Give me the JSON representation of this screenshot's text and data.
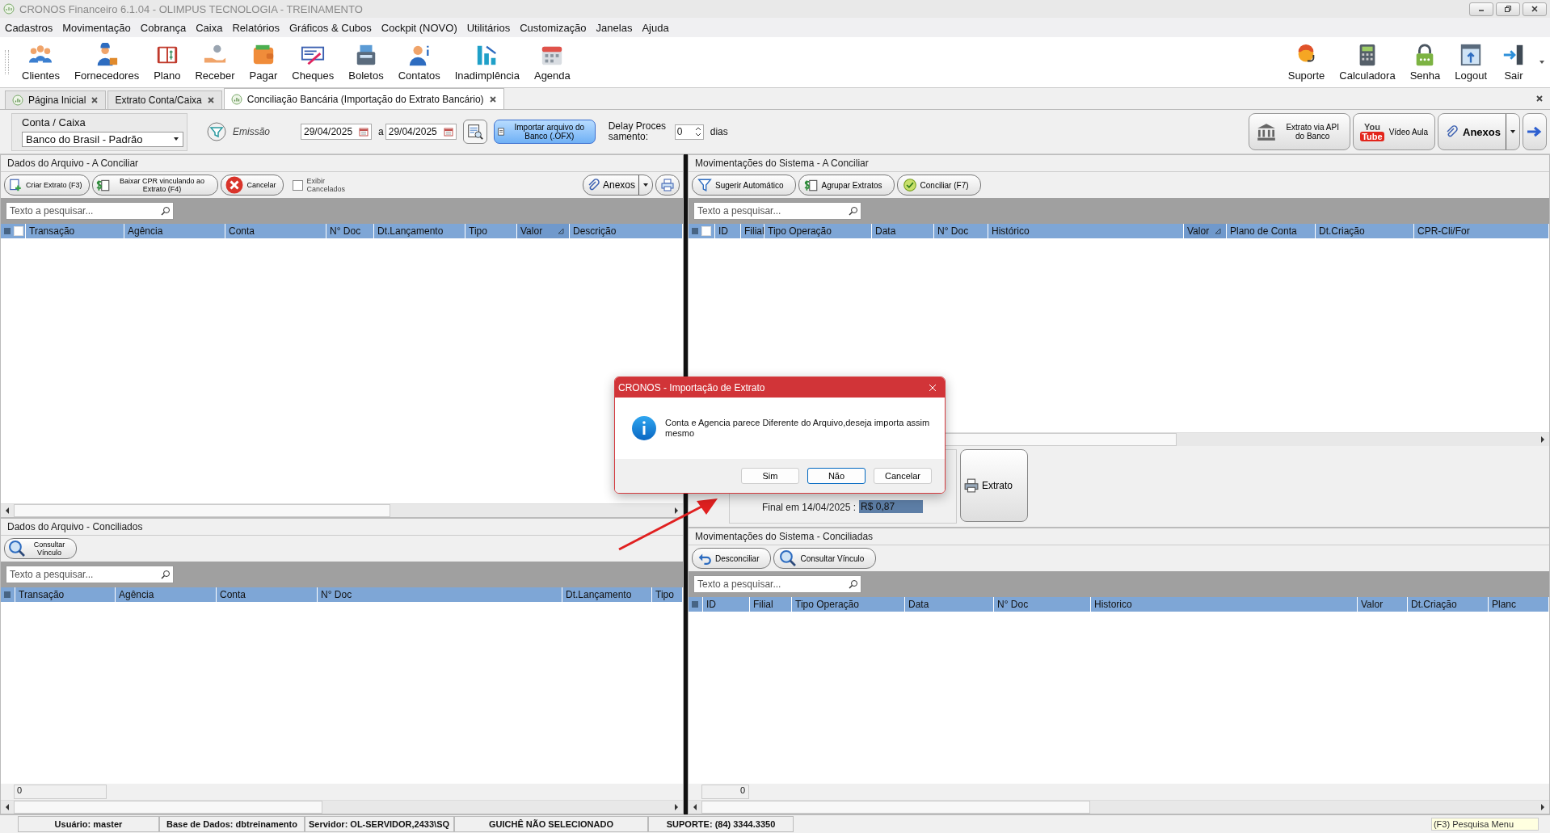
{
  "window": {
    "title": "CRONOS Financeiro 6.1.04 - OLIMPUS TECNOLOGIA - TREINAMENTO"
  },
  "menu": [
    "Cadastros",
    "Movimentação",
    "Cobrança",
    "Caixa",
    "Relatórios",
    "Gráficos & Cubos",
    "Cockpit (NOVO)",
    "Utilitários",
    "Customização",
    "Janelas",
    "Ajuda"
  ],
  "toolbar_left": [
    {
      "label": "Clientes",
      "kind": "people"
    },
    {
      "label": "Fornecedores",
      "kind": "worker"
    },
    {
      "label": "Plano",
      "kind": "ledger"
    },
    {
      "label": "Receber",
      "kind": "hand"
    },
    {
      "label": "Pagar",
      "kind": "wallet"
    },
    {
      "label": "Cheques",
      "kind": "cheque"
    },
    {
      "label": "Boletos",
      "kind": "printer"
    },
    {
      "label": "Contatos",
      "kind": "contact"
    },
    {
      "label": "Inadimplência",
      "kind": "chart"
    },
    {
      "label": "Agenda",
      "kind": "calendar"
    }
  ],
  "toolbar_right": [
    {
      "label": "Suporte",
      "kind": "support"
    },
    {
      "label": "Calculadora",
      "kind": "calc"
    },
    {
      "label": "Senha",
      "kind": "lock"
    },
    {
      "label": "Logout",
      "kind": "logout"
    },
    {
      "label": "Sair",
      "kind": "exit"
    }
  ],
  "tabs": [
    {
      "label": "Página Inicial",
      "selected": false,
      "has_icon": true
    },
    {
      "label": "Extrato Conta/Caixa",
      "selected": false,
      "has_icon": false
    },
    {
      "label": "Conciliação Bancária (Importação do Extrato Bancário)",
      "selected": true,
      "has_icon": true
    }
  ],
  "filter": {
    "account_label": "Conta / Caixa",
    "account_value": "Banco do Brasil - Padrão",
    "date_label": "Emissão",
    "date_from": "29/04/2025",
    "date_sep": "a",
    "date_to": "29/04/2025",
    "import_button": "Importar arquivo do Banco (.OFX)",
    "delay_label": "Delay Processamento:",
    "delay_value": "0",
    "delay_unit": "dias",
    "api_button": "Extrato via API do Banco",
    "youtube_top": "You",
    "youtube_bottom": "Tube",
    "video_button": "Vídeo Aula",
    "attachments_button": "Anexos"
  },
  "file_pending": {
    "title": "Dados do Arquivo - A Conciliar",
    "buttons": [
      {
        "label": "Criar Extrato (F3)",
        "kind": "add"
      },
      {
        "label": "Baixar CPR vinculando ao Extrato (F4)",
        "kind": "money"
      },
      {
        "label": "Cancelar",
        "kind": "cancel"
      }
    ],
    "show_cancelled": {
      "label": "Exibir Cancelados",
      "checked": false
    },
    "attachments": "Anexos",
    "search": {
      "placeholder": "Texto a pesquisar..."
    },
    "select_all": false,
    "columns": [
      {
        "label": "Transação",
        "sorted": false
      },
      {
        "label": "Agência",
        "sorted": false
      },
      {
        "label": "Conta",
        "sorted": false
      },
      {
        "label": "N° Doc",
        "sorted": false
      },
      {
        "label": "Dt.Lançamento",
        "sorted": false
      },
      {
        "label": "Tipo",
        "sorted": false
      },
      {
        "label": "Valor",
        "sorted": true
      },
      {
        "label": "Descrição",
        "sorted": false
      }
    ]
  },
  "file_reconciled": {
    "title": "Dados do Arquivo - Conciliados",
    "buttons": [
      {
        "label": "Consultar Vínculo",
        "kind": "search"
      }
    ],
    "search": {
      "placeholder": "Texto a pesquisar..."
    },
    "columns": [
      {
        "label": "Transação",
        "sorted": false
      },
      {
        "label": "Agência",
        "sorted": false
      },
      {
        "label": "Conta",
        "sorted": false
      },
      {
        "label": "N° Doc",
        "sorted": false
      },
      {
        "label": "Dt.Lançamento",
        "sorted": false
      },
      {
        "label": "Tipo",
        "sorted": false
      }
    ],
    "footer": "0"
  },
  "system_pending": {
    "title": "Movimentações do Sistema - A Conciliar",
    "buttons": [
      {
        "label": "Sugerir Automático",
        "kind": "filter"
      },
      {
        "label": "Agrupar Extratos",
        "kind": "money"
      },
      {
        "label": "Conciliar (F7)",
        "kind": "check"
      }
    ],
    "search": {
      "placeholder": "Texto a pesquisar..."
    },
    "select_all": false,
    "columns": [
      {
        "label": "ID",
        "sorted": false
      },
      {
        "label": "Filial",
        "sorted": false
      },
      {
        "label": "Tipo Operação",
        "sorted": false
      },
      {
        "label": "Data",
        "sorted": false
      },
      {
        "label": "N° Doc",
        "sorted": false
      },
      {
        "label": "Histórico",
        "sorted": false
      },
      {
        "label": "Valor",
        "sorted": true
      },
      {
        "label": "Plano de Conta",
        "sorted": false
      },
      {
        "label": "Dt.Criação",
        "sorted": false
      },
      {
        "label": "CPR-Cli/For",
        "sorted": false
      }
    ],
    "final_label": "Final em 14/04/2025 :",
    "final_value": "R$ 0,87",
    "statement_button": "Extrato"
  },
  "system_reconciled": {
    "title": "Movimentações do Sistema - Conciliadas",
    "buttons": [
      {
        "label": "Desconciliar",
        "kind": "undo"
      },
      {
        "label": "Consultar Vínculo",
        "kind": "search"
      }
    ],
    "search": {
      "placeholder": "Texto a pesquisar..."
    },
    "columns": [
      {
        "label": "ID",
        "sorted": false
      },
      {
        "label": "Filial",
        "sorted": false
      },
      {
        "label": "Tipo Operação",
        "sorted": false
      },
      {
        "label": "Data",
        "sorted": false
      },
      {
        "label": "N° Doc",
        "sorted": false
      },
      {
        "label": "Historico",
        "sorted": false
      },
      {
        "label": "Valor",
        "sorted": false
      },
      {
        "label": "Dt.Criação",
        "sorted": false
      },
      {
        "label": "Planc",
        "sorted": false
      }
    ],
    "footer": "0"
  },
  "status_bar": [
    "Usuário: master",
    "Base de Dados: dbtreinamento",
    "Servidor: OL-SERVIDOR,2433\\SQ",
    "GUICHÊ NÃO SELECIONADO",
    "SUPORTE: (84) 3344.3350"
  ],
  "status_hint": "(F3) Pesquisa Menu",
  "dialog": {
    "title": "CRONOS - Importação de Extrato",
    "message": "Conta e Agencia parece Diferente do Arquivo,deseja importa assim mesmo",
    "buttons": [
      {
        "label": "Sim",
        "selected": false
      },
      {
        "label": "Não",
        "selected": true
      },
      {
        "label": "Cancelar",
        "selected": false
      }
    ]
  }
}
